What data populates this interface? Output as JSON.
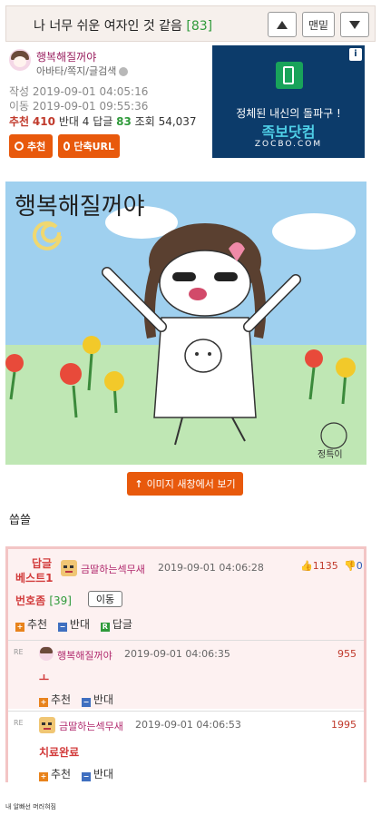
{
  "post": {
    "title": "나 너무 쉬운 여자인 것 같음",
    "comment_count": "[83]",
    "nav": {
      "bottom_label": "맨밑"
    },
    "author": {
      "nickname": "행복해질꺼야",
      "links": "아바타/쪽지/글검색"
    },
    "written_label": "작성",
    "written_at": "2019-09-01 04:05:16",
    "moved_label": "이동",
    "moved_at": "2019-09-01 09:55:36",
    "stats": {
      "rec_label": "추천",
      "rec": "410",
      "opp_label": "반대",
      "opp": "4",
      "reply_label": "답글",
      "reply": "83",
      "view_label": "조회",
      "view": "54,037"
    },
    "buttons": {
      "recommend": "추천",
      "short_url": "단축URL"
    },
    "image_caption": "행복해질꺼야",
    "image_signature": "정특이",
    "open_image_label": "이미지 새창에서 보기",
    "body": "씁쓸"
  },
  "ad": {
    "info": "i",
    "line1": "정체된 내신의 돌파구 !",
    "brand": "족보닷컴",
    "domain": "ZOCBO.COM"
  },
  "comments": {
    "best": {
      "label_line1": "답글",
      "label_line2": "베스트1",
      "nickname": "금딸하는섹무새",
      "date": "2019-09-01 04:06:28",
      "up": "1135",
      "down": "0",
      "number_label": "번호좀",
      "number_count": "[39]",
      "move_label": "이동",
      "actions": {
        "rec": "추천",
        "opp": "반대",
        "reply": "답글"
      }
    },
    "replies": [
      {
        "re": "RE",
        "nickname": "행복해질꺼야",
        "date": "2019-09-01 04:06:35",
        "score": "955",
        "text": "ㅗ",
        "rec": "추천",
        "opp": "반대"
      },
      {
        "re": "RE",
        "nickname": "금딸하는섹무새",
        "date": "2019-09-01 04:06:53",
        "score": "1995",
        "text": "치료완료",
        "rec": "추천",
        "opp": "반대"
      }
    ]
  },
  "footer": "내 알빠선 머러혀짐",
  "colors": {
    "accent": "#e8590c",
    "nick": "#b12a6e",
    "count_green": "#2f9a3a",
    "red": "#c0392b"
  }
}
